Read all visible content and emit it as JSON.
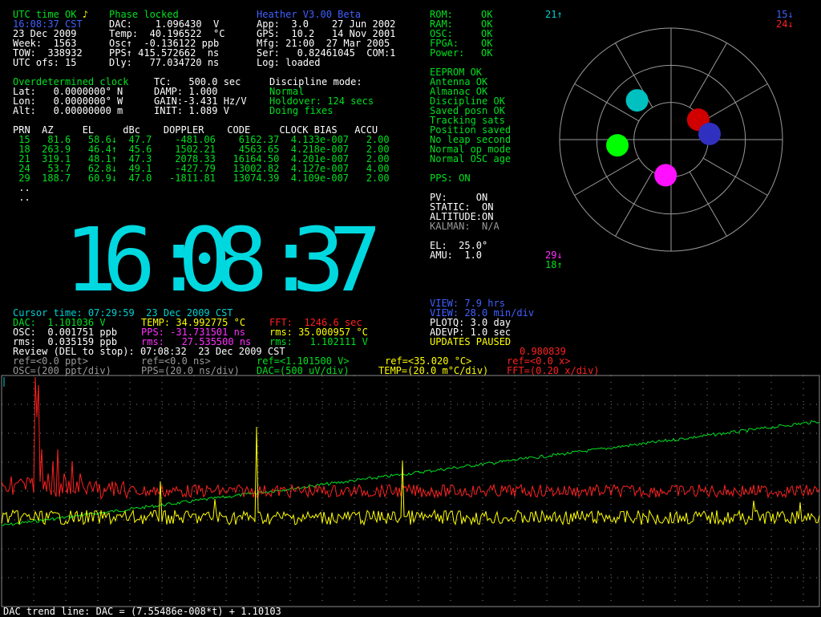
{
  "status": {
    "utc_ok": "UTC time OK",
    "phase": "Phase locked",
    "time": "16:08:37 CST",
    "date": "23 Dec 2009",
    "week": "Week:  1563",
    "tow": "TOW:  338932",
    "utc_ofs": "UTC ofs: 15",
    "dac": "DAC:    1.096430  V",
    "temp": "Temp:  40.196522  °C",
    "osc": "Osc↑  -0.136122 ppb",
    "pps": "PPS↑ 415.572662  ns",
    "dly": "Dly:   77.034720 ns"
  },
  "version": {
    "title": "Heather V3.00 Beta",
    "app": "App:  3.0    27 Jun 2002",
    "gps": "GPS:  10.2   14 Nov 2001",
    "mfg": "Mfg: 21:00  27 Mar 2005",
    "ser": "Ser:   0.82461045  COM:1",
    "log": "Log: loaded"
  },
  "health": [
    {
      "label": "ROM:",
      "val": "OK"
    },
    {
      "label": "RAM:",
      "val": "OK"
    },
    {
      "label": "OSC:",
      "val": "OK"
    },
    {
      "label": "FPGA:",
      "val": "OK"
    },
    {
      "label": "Power:",
      "val": "OK"
    }
  ],
  "status_list": [
    "EEPROM OK",
    "Antenna OK",
    "Almanac OK",
    "Discipline OK",
    "Saved posn OK",
    "Tracking sats",
    "Position saved",
    "No leap second",
    "Normal op mode",
    "Normal OSC age"
  ],
  "pps_on": "PPS: ON",
  "flags": {
    "pv": "PV:     ON",
    "static": "STATIC:  ON",
    "altitude": "ALTITUDE:ON",
    "kalman": "KALMAN:  N/A",
    "el": "EL:  25.0°",
    "amu": "AMU:  1.0"
  },
  "clock_mode": {
    "title": "Overdetermined clock",
    "tc": "TC:   500.0 sec",
    "disc_label": "Discipline mode:",
    "lat": "Lat:   0.0000000° N",
    "lon": "Lon:   0.0000000° W",
    "alt": "Alt:   0.00000000 m",
    "damp": "DAMP: 1.000",
    "gain": "GAIN:-3.431 Hz/V",
    "init": "INIT: 1.089 V",
    "normal": "Normal",
    "holdover": "Holdover: 124 secs",
    "doing": "Doing fixes"
  },
  "sat_table": {
    "headers": "PRN  AZ     EL     dBc    DOPPLER    CODE     CLOCK BIAS   ACCU",
    "rows": [
      " 15   81.6   58.6↓  47.7    -481.06    6162.37  4.133e-007   2.00",
      " 18  263.9   46.4↑  45.6    1502.21    4563.65  4.218e-007   2.00",
      " 21  319.1   48.1↑  47.3    2078.33   16164.50  4.201e-007   2.00",
      " 24   53.7   62.8↓  49.1    -427.79   13002.82  4.127e-007   4.00",
      " 29  188.7   60.9↓  47.0   -1811.81   13074.39  4.109e-007   2.00"
    ],
    "dots1": " ..",
    "dots2": " .."
  },
  "big_clock": {
    "d1": "1",
    "d2": "6",
    "c1": ":",
    "d3": "0",
    "d4": "8",
    "c2": ":",
    "d5": "3",
    "d6": "7"
  },
  "sky": {
    "labels": [
      {
        "text": "21↑",
        "color": "#00d0d0"
      },
      {
        "text": "15↓",
        "color": "#4060ff"
      },
      {
        "text": "24↓",
        "color": "#ff2020"
      },
      {
        "text": "29↓",
        "color": "#ff30ff"
      },
      {
        "text": "18↑",
        "color": "#00e020"
      }
    ],
    "sats": [
      {
        "prn": "21",
        "color": "#00c0c0"
      },
      {
        "prn": "24",
        "color": "#d00000"
      },
      {
        "prn": "15",
        "color": "#3030c0"
      },
      {
        "prn": "18",
        "color": "#00ff00"
      },
      {
        "prn": "29",
        "color": "#ff10ff"
      }
    ]
  },
  "cursor": {
    "time": "Cursor time: 07:29:59  23 Dec 2009 CST",
    "dac": "DAC:  1.101036 V",
    "temp": "TEMP: 34.992775 °C",
    "fft": "FFT:  1246.6 sec",
    "osc": "OSC:  0.001751 ppb",
    "pps": "PPS: -31.731501 ns",
    "rms1": "rms: 35.000957 °C",
    "rms_osc": "rms:  0.035159 ppb",
    "rms_pps": "rms:   27.535500 ns",
    "rms_dac": "rms:   1.102111 V",
    "review": "Review (DEL to stop): 07:08:32  23 Dec 2009 CST",
    "value": "0.980839"
  },
  "view": {
    "hrs": "VIEW: 7.9 hrs",
    "div": "VIEW: 28.0 min/div",
    "plotq": "PLOTQ: 3.0 day",
    "adevp": "ADEVP: 1.0 sec",
    "paused": "UPDATES PAUSED"
  },
  "legend": {
    "osc_ref": "ref=<0.0 ppt>",
    "osc_scale": "OSC=(200 ppt/div)",
    "pps_ref": "ref=<0.0 ns>",
    "pps_scale": "PPS=(20.0 ns/div)",
    "dac_ref": "ref=<1.101500 V>",
    "dac_scale": "DAC=(500 uV/div)",
    "temp_ref": "ref=<35.020 °C>",
    "temp_scale": "TEMP=(20.0 m°C/div)",
    "fft_ref": "ref=<0.0 x>",
    "fft_scale": "FFT=(0.20 x/div)"
  },
  "trend": "DAC trend line: DAC = (7.55486e-008*t) + 1.10103",
  "colors": {
    "dac": "#00e020",
    "temp": "#ffff00",
    "fft": "#ff2020",
    "grid": "#8a8a8a"
  }
}
